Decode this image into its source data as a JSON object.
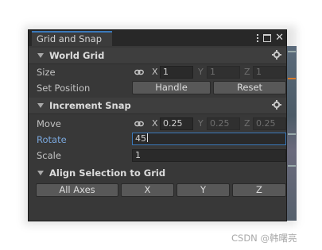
{
  "window": {
    "tab_title": "Grid and Snap"
  },
  "world_grid": {
    "title": "World Grid",
    "size": {
      "label": "Size",
      "x_label": "X",
      "x": "1",
      "y_label": "Y",
      "y": "1",
      "z_label": "Z",
      "z": "1"
    },
    "set_position": {
      "label": "Set Position",
      "handle_button": "Handle",
      "reset_button": "Reset"
    }
  },
  "increment_snap": {
    "title": "Increment Snap",
    "move": {
      "label": "Move",
      "x_label": "X",
      "x": "0.25",
      "y_label": "Y",
      "y": "0.25",
      "z_label": "Z",
      "z": "0.25"
    },
    "rotate": {
      "label": "Rotate",
      "value": "45"
    },
    "scale": {
      "label": "Scale",
      "value": "1"
    }
  },
  "align": {
    "title": "Align Selection to Grid",
    "buttons": [
      "All Axes",
      "X",
      "Y",
      "Z"
    ]
  },
  "watermark": "CSDN @韩曙亮",
  "colors": {
    "accent": "#3a79bb",
    "panel": "#383838",
    "field": "#2a2a2a",
    "button": "#585858"
  }
}
